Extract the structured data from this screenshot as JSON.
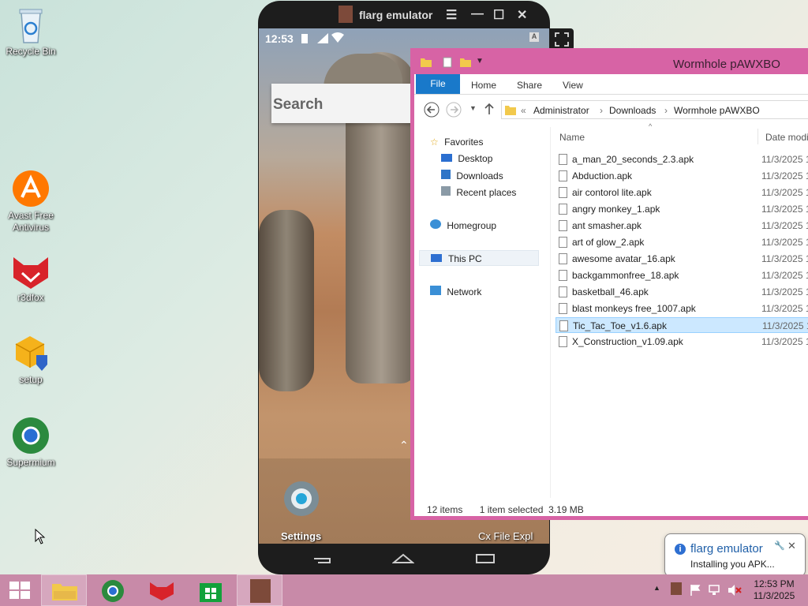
{
  "desktop": {
    "icons": [
      {
        "label": "Recycle Bin"
      },
      {
        "label": "Avast Free Antivirus"
      },
      {
        "label": "r3dfox"
      },
      {
        "label": "setup"
      },
      {
        "label": "Supermium"
      }
    ]
  },
  "emulator": {
    "title": "flarg emulator",
    "status_time": "12:53",
    "search_placeholder": "Search",
    "settings_label": "Settings",
    "file_explorer_label": "Cx File Expl"
  },
  "explorer": {
    "title": "Wormhole pAWXBO",
    "ribbon_tabs": [
      "File",
      "Home",
      "Share",
      "View"
    ],
    "address": {
      "prefix": "«",
      "segments": [
        "Administrator",
        "Downloads",
        "Wormhole pAWXBO"
      ]
    },
    "nav": {
      "favorites": "Favorites",
      "desktop": "Desktop",
      "downloads": "Downloads",
      "recent": "Recent places",
      "homegroup": "Homegroup",
      "thispc": "This PC",
      "network": "Network"
    },
    "columns": {
      "name": "Name",
      "date": "Date modif"
    },
    "files": [
      {
        "name": "a_man_20_seconds_2.3.apk",
        "date": "11/3/2025 1"
      },
      {
        "name": "Abduction.apk",
        "date": "11/3/2025 1"
      },
      {
        "name": "air contorol lite.apk",
        "date": "11/3/2025 1"
      },
      {
        "name": "angry monkey_1.apk",
        "date": "11/3/2025 1"
      },
      {
        "name": "ant smasher.apk",
        "date": "11/3/2025 1"
      },
      {
        "name": "art of glow_2.apk",
        "date": "11/3/2025 1"
      },
      {
        "name": "awesome avatar_16.apk",
        "date": "11/3/2025 1"
      },
      {
        "name": "backgammonfree_18.apk",
        "date": "11/3/2025 1"
      },
      {
        "name": "basketball_46.apk",
        "date": "11/3/2025 1"
      },
      {
        "name": "blast monkeys free_1007.apk",
        "date": "11/3/2025 1"
      },
      {
        "name": "Tic_Tac_Toe_v1.6.apk",
        "date": "11/3/2025 1",
        "selected": true
      },
      {
        "name": "X_Construction_v1.09.apk",
        "date": "11/3/2025 1"
      }
    ],
    "status": {
      "count": "12 items",
      "selection": "1 item selected  3.19 MB"
    }
  },
  "notification": {
    "title": "flarg emulator",
    "message": "Installing you APK..."
  },
  "taskbar": {
    "clock_time": "12:53 PM",
    "clock_date": "11/3/2025"
  },
  "colors": {
    "explorer_border": "#d763a5",
    "taskbar": "#c88aa8",
    "file_tab": "#1979ca",
    "selection": "#cce8ff"
  }
}
